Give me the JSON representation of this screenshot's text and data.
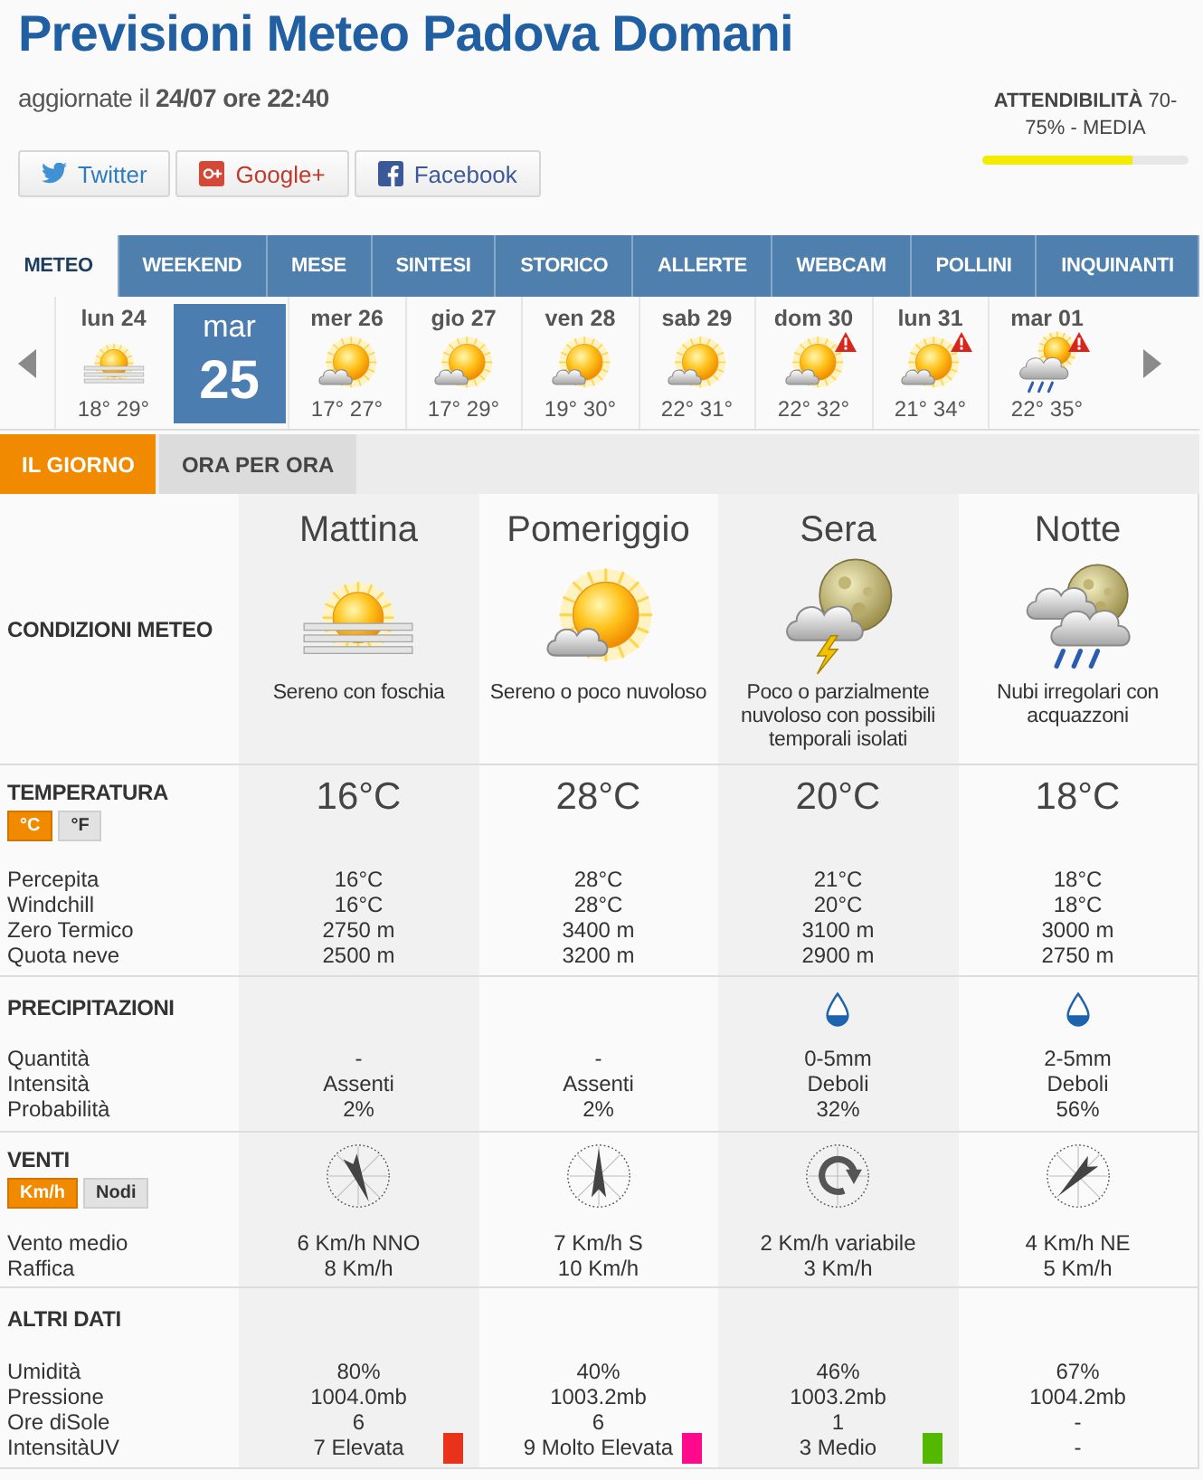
{
  "header": {
    "title": "Previsioni Meteo Padova Domani",
    "updated": "aggiornate il **24/07 ore 22:40**",
    "share_buttons": [
      {
        "kind": "twitter",
        "label": "Twitter"
      },
      {
        "kind": "googleplus",
        "label": "Google+"
      },
      {
        "kind": "facebook",
        "label": "Facebook"
      }
    ],
    "reliability": {
      "text": "**ATTENDIBILITÀ** 70-75% - MEDIA",
      "level": 0.73
    }
  },
  "nav_tabs": [
    {
      "label": "METEO",
      "selected": true
    },
    {
      "label": "WEEKEND",
      "selected": false
    },
    {
      "label": "MESE",
      "selected": false
    },
    {
      "label": "SINTESI",
      "selected": false
    },
    {
      "label": "STORICO",
      "selected": false
    },
    {
      "label": "ALLERTE",
      "selected": false
    },
    {
      "label": "WEBCAM",
      "selected": false
    },
    {
      "label": "POLLINI",
      "selected": false
    },
    {
      "label": "INQUINANTI",
      "selected": false
    }
  ],
  "days": [
    {
      "label": "lun 24",
      "kind": "haze",
      "temps": "18° 29°",
      "alert": false,
      "selected": false
    },
    {
      "weekday": "mar",
      "date": "25",
      "selected": true
    },
    {
      "label": "mer 26",
      "kind": "fair",
      "temps": "17° 27°",
      "alert": false,
      "selected": false
    },
    {
      "label": "gio 27",
      "kind": "fair",
      "temps": "17° 29°",
      "alert": false,
      "selected": false
    },
    {
      "label": "ven 28",
      "kind": "fair",
      "temps": "19° 30°",
      "alert": false,
      "selected": false
    },
    {
      "label": "sab 29",
      "kind": "fair",
      "temps": "22° 31°",
      "alert": false,
      "selected": false
    },
    {
      "label": "dom 30",
      "kind": "fair",
      "temps": "22° 32°",
      "alert": true,
      "selected": false
    },
    {
      "label": "lun 31",
      "kind": "fair",
      "temps": "21° 34°",
      "alert": true,
      "selected": false
    },
    {
      "label": "mar 01",
      "kind": "showers",
      "temps": "22° 35°",
      "alert": true,
      "selected": false
    }
  ],
  "day_tabs": [
    {
      "label": "IL GIORNO",
      "selected": true
    },
    {
      "label": "ORA PER ORA",
      "selected": false
    }
  ],
  "conditions": {
    "label": "CONDIZIONI METEO",
    "periods": [
      {
        "name": "Mattina",
        "kind": "haze",
        "description": "Sereno con foschia"
      },
      {
        "name": "Pomeriggio",
        "kind": "fair",
        "description": "Sereno o poco nuvoloso"
      },
      {
        "name": "Sera",
        "kind": "night-storm",
        "description": "Poco o parzialmente nuvoloso con possibili temporali isolati"
      },
      {
        "name": "Notte",
        "kind": "night-showers",
        "description": "Nubi irregolari con acquazzoni"
      }
    ]
  },
  "sections": [
    {
      "kind": "temperature",
      "title": "TEMPERATURA",
      "units": [
        {
          "label": "°C",
          "selected": true
        },
        {
          "label": "°F",
          "selected": false
        }
      ],
      "headline": [
        "16°C",
        "28°C",
        "20°C",
        "18°C"
      ],
      "rows": [
        {
          "label": "Percepita",
          "values": [
            "16°C",
            "28°C",
            "21°C",
            "18°C"
          ]
        },
        {
          "label": "Windchill",
          "values": [
            "16°C",
            "28°C",
            "20°C",
            "18°C"
          ]
        },
        {
          "label": "Zero Termico",
          "values": [
            "2750 m",
            "3400 m",
            "3100 m",
            "3000 m"
          ]
        },
        {
          "label": "Quota neve",
          "values": [
            "2500 m",
            "3200 m",
            "2900 m",
            "2750 m"
          ]
        }
      ]
    },
    {
      "kind": "precipitation",
      "title": "PRECIPITAZIONI",
      "icons": [
        {
          "rain": false
        },
        {
          "rain": false
        },
        {
          "rain": true
        },
        {
          "rain": true
        }
      ],
      "rows": [
        {
          "label": "Quantità",
          "values": [
            "-",
            "-",
            "0-5mm",
            "2-5mm"
          ]
        },
        {
          "label": "Intensità",
          "values": [
            "Assenti",
            "Assenti",
            "Deboli",
            "Deboli"
          ]
        },
        {
          "label": "Probabilità",
          "values": [
            "2%",
            "2%",
            "32%",
            "56%"
          ]
        }
      ]
    },
    {
      "kind": "wind",
      "title": "VENTI",
      "units": [
        {
          "label": "Km/h",
          "selected": true
        },
        {
          "label": "Nodi",
          "selected": false
        }
      ],
      "icons": [
        {
          "kind": "nno"
        },
        {
          "kind": "s"
        },
        {
          "kind": "variable"
        },
        {
          "kind": "ne"
        }
      ],
      "rows": [
        {
          "label": "Vento medio",
          "values": [
            "6 Km/h NNO",
            "7 Km/h S",
            "2 Km/h variabile",
            "4 Km/h NE"
          ]
        },
        {
          "label": "Raffica",
          "values": [
            "8 Km/h",
            "10 Km/h",
            "3 Km/h",
            "5 Km/h"
          ]
        }
      ]
    },
    {
      "kind": "other",
      "title": "ALTRI DATI",
      "rows": [
        {
          "label": "Umidità",
          "values": [
            "80%",
            "40%",
            "46%",
            "67%"
          ]
        },
        {
          "label": "Pressione",
          "values": [
            "1004.0mb",
            "1003.2mb",
            "1003.2mb",
            "1004.2mb"
          ]
        },
        {
          "label": "Ore diSole",
          "values": [
            "6",
            "6",
            "1",
            "-"
          ]
        },
        {
          "label": "IntensitàUV",
          "values": [
            {
              "text": "7 Elevata",
              "color": "#e8321a"
            },
            {
              "text": "9 Molto Elevata",
              "color": "#ff0a8c"
            },
            {
              "text": "3 Medio",
              "color": "#55b800"
            },
            "-"
          ]
        }
      ]
    }
  ]
}
